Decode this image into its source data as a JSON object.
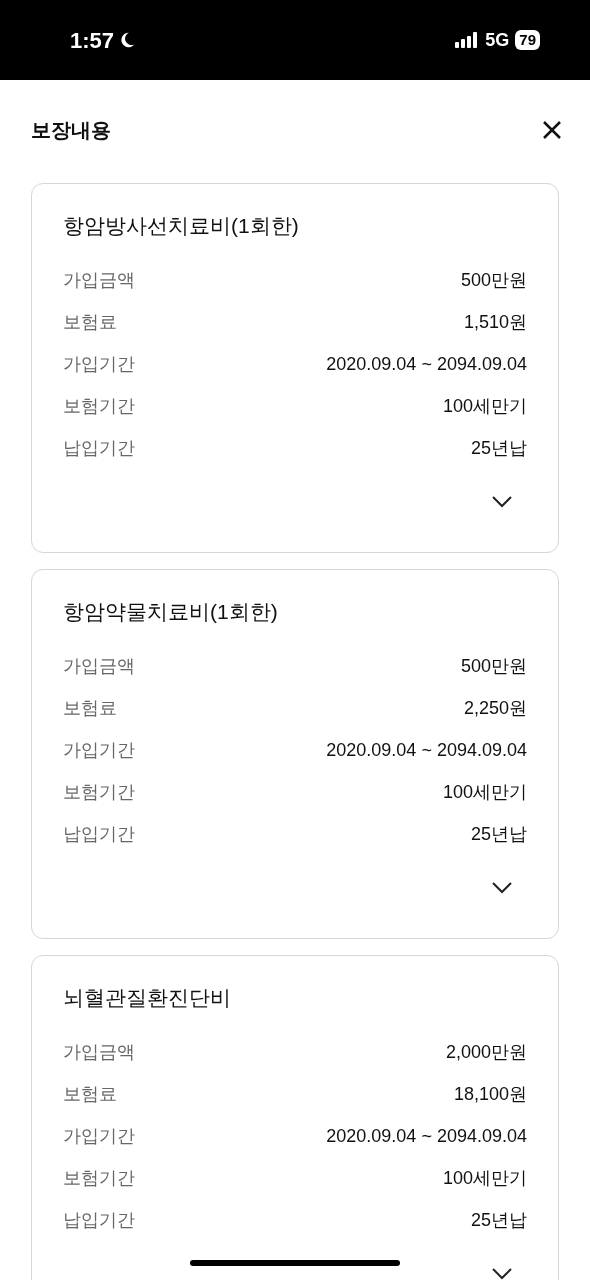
{
  "status_bar": {
    "time": "1:57",
    "network": "5G",
    "battery": "79"
  },
  "header": {
    "title": "보장내용"
  },
  "cards": [
    {
      "title": "항암방사선치료비(1회한)",
      "rows": [
        {
          "label": "가입금액",
          "value": "500만원"
        },
        {
          "label": "보험료",
          "value": "1,510원"
        },
        {
          "label": "가입기간",
          "value": "2020.09.04 ~ 2094.09.04"
        },
        {
          "label": "보험기간",
          "value": "100세만기"
        },
        {
          "label": "납입기간",
          "value": "25년납"
        }
      ]
    },
    {
      "title": "항암약물치료비(1회한)",
      "rows": [
        {
          "label": "가입금액",
          "value": "500만원"
        },
        {
          "label": "보험료",
          "value": "2,250원"
        },
        {
          "label": "가입기간",
          "value": "2020.09.04 ~ 2094.09.04"
        },
        {
          "label": "보험기간",
          "value": "100세만기"
        },
        {
          "label": "납입기간",
          "value": "25년납"
        }
      ]
    },
    {
      "title": "뇌혈관질환진단비",
      "rows": [
        {
          "label": "가입금액",
          "value": "2,000만원"
        },
        {
          "label": "보험료",
          "value": "18,100원"
        },
        {
          "label": "가입기간",
          "value": "2020.09.04 ~ 2094.09.04"
        },
        {
          "label": "보험기간",
          "value": "100세만기"
        },
        {
          "label": "납입기간",
          "value": "25년납"
        }
      ]
    }
  ]
}
